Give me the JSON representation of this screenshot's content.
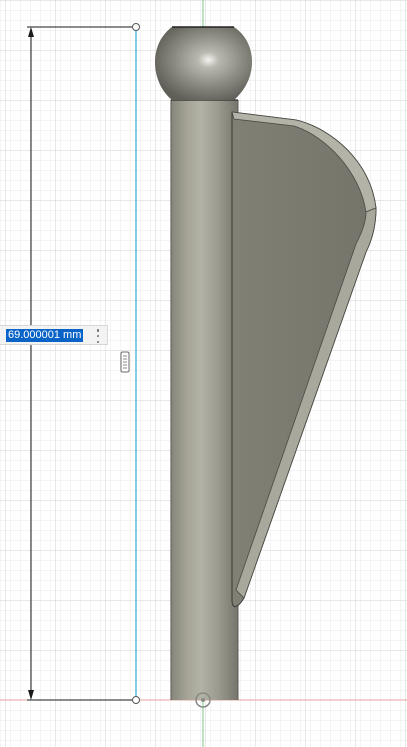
{
  "dimension": {
    "value": "69.000001 mm"
  },
  "icons": {
    "menu": "more-vertical-icon",
    "handle": "dimension-drag-handle-icon",
    "origin": "origin-point-icon"
  },
  "colors": {
    "grid_minor": "#e6e6e6",
    "grid_major": "#cfcfcf",
    "axis_green": "#7fc98a",
    "axis_red": "#e7a2a2",
    "sketch_line": "#5bb8e6",
    "dimension_line": "#1a1a1a",
    "body_light": "#a5a497",
    "body_dark": "#6a6a62",
    "selection": "#0a64c8"
  }
}
